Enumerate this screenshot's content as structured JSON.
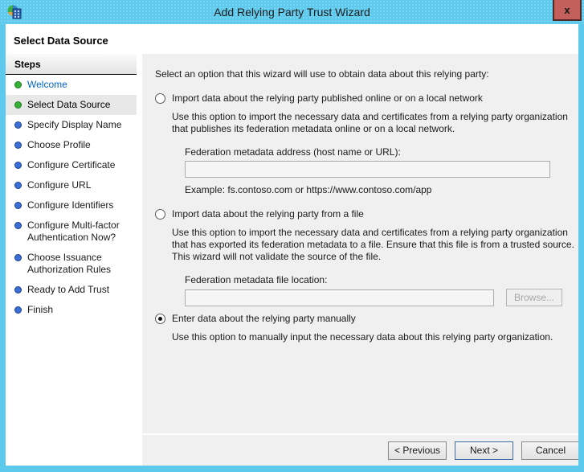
{
  "window": {
    "title": "Add Relying Party Trust Wizard",
    "close_label": "x"
  },
  "header": {
    "title": "Select Data Source"
  },
  "sidebar": {
    "title": "Steps",
    "items": [
      {
        "label": "Welcome",
        "state": "done"
      },
      {
        "label": "Select Data Source",
        "state": "current"
      },
      {
        "label": "Specify Display Name",
        "state": "pending"
      },
      {
        "label": "Choose Profile",
        "state": "pending"
      },
      {
        "label": "Configure Certificate",
        "state": "pending"
      },
      {
        "label": "Configure URL",
        "state": "pending"
      },
      {
        "label": "Configure Identifiers",
        "state": "pending"
      },
      {
        "label": "Configure Multi-factor Authentication Now?",
        "state": "pending"
      },
      {
        "label": "Choose Issuance Authorization Rules",
        "state": "pending"
      },
      {
        "label": "Ready to Add Trust",
        "state": "pending"
      },
      {
        "label": "Finish",
        "state": "pending"
      }
    ]
  },
  "main": {
    "intro": "Select an option that this wizard will use to obtain data about this relying party:",
    "options": [
      {
        "label": "Import data about the relying party published online or on a local network",
        "selected": false,
        "description": "Use this option to import the necessary data and certificates from a relying party organization that publishes its federation metadata online or on a local network.",
        "field_label": "Federation metadata address (host name or URL):",
        "field_value": "",
        "example": "Example: fs.contoso.com or https://www.contoso.com/app"
      },
      {
        "label": "Import data about the relying party from a file",
        "selected": false,
        "description": "Use this option to import the necessary data and certificates from a relying party organization that has exported its federation metadata to a file. Ensure that this file is from a trusted source.  This wizard will not validate the source of the file.",
        "field_label": "Federation metadata file location:",
        "field_value": "",
        "browse_label": "Browse..."
      },
      {
        "label": "Enter data about the relying party manually",
        "selected": true,
        "description": "Use this option to manually input the necessary data about this relying party organization."
      }
    ]
  },
  "footer": {
    "previous_label": "< Previous",
    "next_label": "Next >",
    "cancel_label": "Cancel"
  },
  "colors": {
    "frame": "#5dc9ec",
    "close_bg": "#c4605c",
    "close_border": "#4f2a28",
    "link": "#0066cc",
    "bullet_done": "#35b335",
    "bullet_pending": "#3a6fd8",
    "panel": "#f0f0f0",
    "highlight": "#e8e8e8",
    "accent_button_border": "#3c6ea5"
  }
}
